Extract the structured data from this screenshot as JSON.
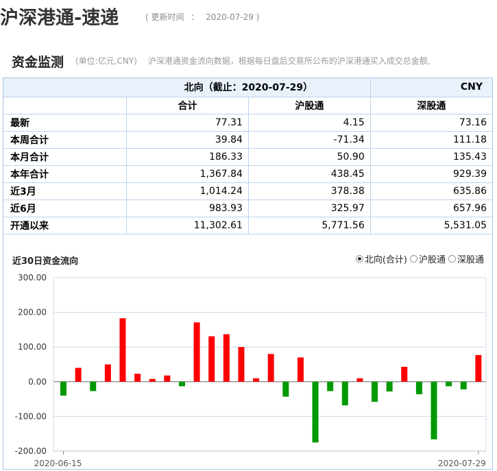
{
  "header": {
    "title": "沪深港通-速递",
    "update_label": "更新时间",
    "update_sep": "：",
    "update_date": "2020-07-29",
    "paren_open": "(",
    "paren_close": ")"
  },
  "section": {
    "title": "资金监测",
    "unit": "(单位:亿元,CNY)",
    "desc": "沪深港通资金流向数据，根据每日盘后交易所公布的沪深港通买入成交总金额,"
  },
  "table": {
    "direction": "北向（截止：2020-07-29）",
    "currency": "CNY",
    "columns": [
      "合计",
      "沪股通",
      "深股通"
    ],
    "rows": [
      {
        "label": "最新",
        "total": "77.31",
        "sh": "4.15",
        "sz": "73.16"
      },
      {
        "label": "本周合计",
        "total": "39.84",
        "sh": "-71.34",
        "sz": "111.18"
      },
      {
        "label": "本月合计",
        "total": "186.33",
        "sh": "50.90",
        "sz": "135.43"
      },
      {
        "label": "本年合计",
        "total": "1,367.84",
        "sh": "438.45",
        "sz": "929.39"
      },
      {
        "label": "近3月",
        "total": "1,014.24",
        "sh": "378.38",
        "sz": "635.86"
      },
      {
        "label": "近6月",
        "total": "983.93",
        "sh": "325.97",
        "sz": "657.96"
      },
      {
        "label": "开通以来",
        "total": "11,302.61",
        "sh": "5,771.56",
        "sz": "5,531.05"
      }
    ]
  },
  "chart_section": {
    "title": "近30日资金流向",
    "options": [
      {
        "label": "北向(合计)",
        "selected": true
      },
      {
        "label": "沪股通",
        "selected": false
      },
      {
        "label": "深股通",
        "selected": false
      }
    ]
  },
  "chart_data": {
    "type": "bar",
    "title": "近30日资金流向",
    "xlabel": "",
    "ylabel": "",
    "ylim": [
      -200,
      300
    ],
    "y_ticks": [
      "300.00",
      "200.00",
      "100.00",
      "0.00",
      "-100.00",
      "-200.00"
    ],
    "x_tick_labels": [
      "2020-06-15",
      "2020-07-29"
    ],
    "positive_color": "#ff0000",
    "negative_color": "#009900",
    "values": [
      -40,
      40,
      -27,
      50,
      183,
      23,
      8,
      18,
      -13,
      171,
      131,
      137,
      100,
      10,
      80,
      -43,
      70,
      -175,
      -27,
      -68,
      10,
      -58,
      -28,
      43,
      -36,
      -166,
      -13,
      -22,
      77
    ]
  }
}
